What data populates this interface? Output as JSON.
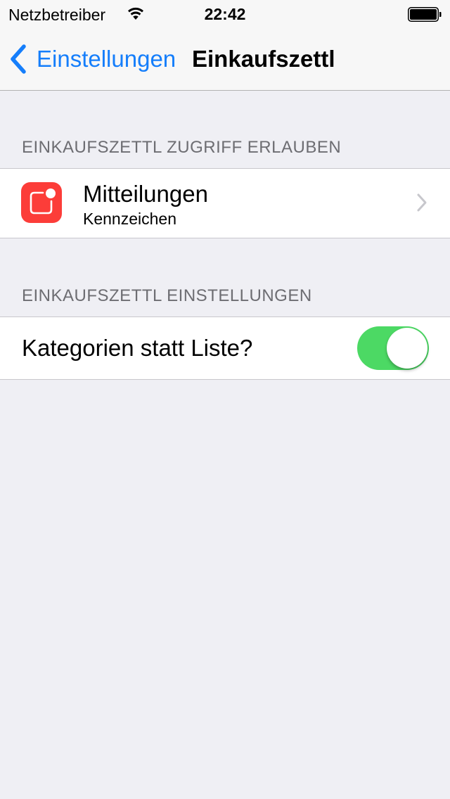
{
  "status_bar": {
    "carrier": "Netzbetreiber",
    "time": "22:42",
    "wifi_icon": "wifi-icon",
    "battery_icon": "battery-icon"
  },
  "nav": {
    "back_label": "Einstellungen",
    "title": "Einkaufszettl",
    "back_icon": "chevron-left-icon"
  },
  "sections": [
    {
      "header": "EINKAUFSZETTL ZUGRIFF ERLAUBEN",
      "rows": [
        {
          "title": "Mitteilungen",
          "subtitle": "Kennzeichen",
          "icon": "notifications-icon",
          "accessory": "chevron-right-icon"
        }
      ]
    },
    {
      "header": "EINKAUFSZETTL EINSTELLUNGEN",
      "rows": [
        {
          "title": "Kategorien statt Liste?",
          "toggle_on": true
        }
      ]
    }
  ],
  "colors": {
    "accent": "#157efb",
    "toggle_on": "#4cd964",
    "notifications_icon_bg": "#fc3d39",
    "background": "#efeff4",
    "section_header": "#6d6d72"
  }
}
